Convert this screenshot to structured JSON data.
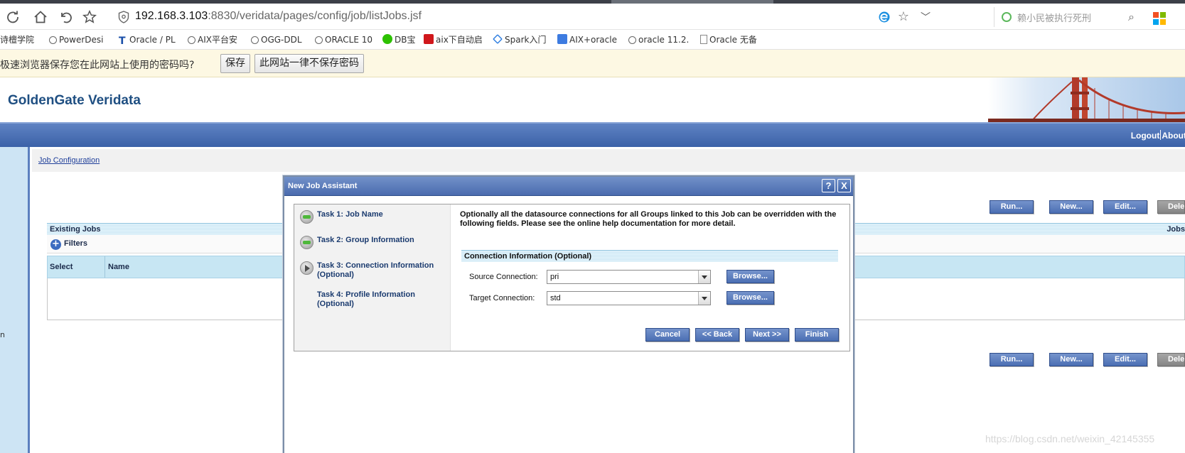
{
  "browser": {
    "url_host": "192.168.3.103",
    "url_rest": ":8830/veridata/pages/config/job/listJobs.jsf",
    "search_text": "赖小民被执行死刑",
    "bookmarks": [
      {
        "label": "诗檀学院",
        "icon": "none"
      },
      {
        "label": "PowerDesi",
        "icon": "logo-icon"
      },
      {
        "label": "Oracle / PL",
        "icon": "t-icon"
      },
      {
        "label": "AIX平台安",
        "icon": "logo-icon"
      },
      {
        "label": "OGG-DDL",
        "icon": "logo-icon"
      },
      {
        "label": "ORACLE 10",
        "icon": "logo-icon"
      },
      {
        "label": "DB宝",
        "icon": "wechat-icon"
      },
      {
        "label": "aix下自动启",
        "icon": "csdn-icon"
      },
      {
        "label": "Spark入门",
        "icon": "diamond-icon"
      },
      {
        "label": "AIX+oracle",
        "icon": "pen-icon"
      },
      {
        "label": "oracle 11.2.",
        "icon": "logo-icon"
      },
      {
        "label": "Oracle 无备",
        "icon": "page-icon"
      }
    ],
    "password_prompt": {
      "message": "极速浏览器保存您在此网站上使用的密码吗?",
      "save_label": "保存",
      "never_label": "此网站一律不保存密码"
    }
  },
  "app": {
    "title": "GoldenGate Veridata",
    "nav": {
      "logout": "Logout",
      "about": "About"
    },
    "breadcrumb": "Job Configuration",
    "actions": {
      "run": "Run...",
      "new": "New...",
      "edit": "Edit...",
      "delete": "Delete"
    },
    "existing_jobs": {
      "title": "Existing Jobs",
      "right_label": "Jobs",
      "filters_label": "Filters",
      "columns": [
        "Select",
        "Name"
      ]
    },
    "left_fragment": "n"
  },
  "dialog": {
    "title": "New Job Assistant",
    "help": "?",
    "close": "X",
    "steps": [
      {
        "label": "Task 1: Job Name",
        "state": "done"
      },
      {
        "label": "Task 2: Group Information",
        "state": "done"
      },
      {
        "label": "Task 3: Connection Information (Optional)",
        "state": "current"
      },
      {
        "label": "Task 4: Profile Information (Optional)",
        "state": "pending"
      }
    ],
    "description": "Optionally all the datasource connections for all Groups linked to this Job can be overridden with the following fields. Please see the online help documentation for more detail.",
    "section_title": "Connection Information (Optional)",
    "source_label": "Source Connection:",
    "source_value": "pri",
    "target_label": "Target Connection:",
    "target_value": "std",
    "browse_label": "Browse...",
    "buttons": {
      "cancel": "Cancel",
      "back": "<< Back",
      "next": "Next >>",
      "finish": "Finish"
    }
  },
  "watermark": "https://blog.csdn.net/weixin_42145355",
  "colors": {
    "brand_blue": "#1f4f82",
    "nav_blue": "#4a6bae",
    "light_blue": "#cde4f4"
  }
}
